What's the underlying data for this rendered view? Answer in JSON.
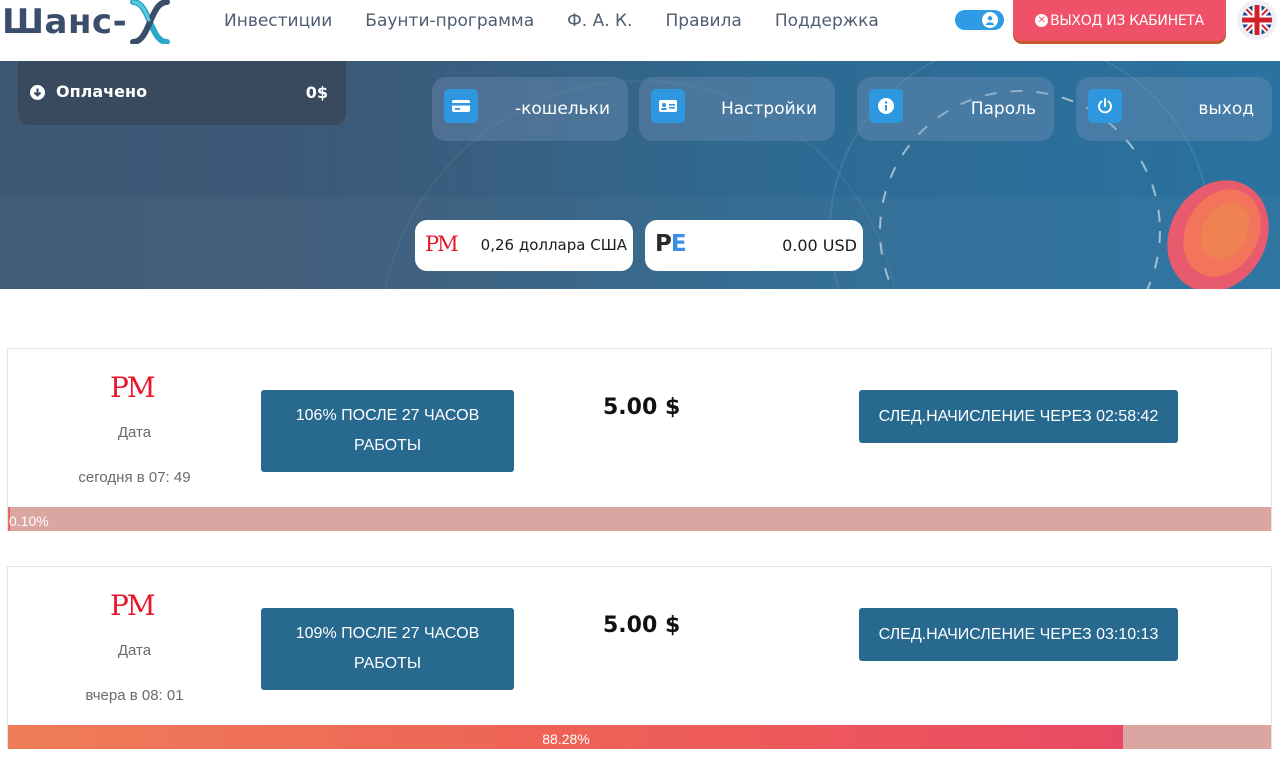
{
  "brand": {
    "name": "Шанс-"
  },
  "nav": {
    "items": [
      {
        "label": "Инвестиции"
      },
      {
        "label": "Баунти-программа"
      },
      {
        "label": "Ф. А. К."
      },
      {
        "label": "Правила"
      },
      {
        "label": "Поддержка"
      }
    ]
  },
  "header": {
    "exit_label": "ВЫХОД ИЗ КАБИНЕТА",
    "language_icon": "uk-flag-icon"
  },
  "banner": {
    "paid_label": "Оплачено",
    "paid_value": "0$",
    "menu": [
      {
        "label": "-кошельки",
        "icon": "card-icon"
      },
      {
        "label": "Настройки",
        "icon": "id-card-icon"
      },
      {
        "label": "Пароль",
        "icon": "info-icon"
      },
      {
        "label": "выход",
        "icon": "power-icon"
      }
    ],
    "balances": [
      {
        "system": "PM",
        "value": "0,26 доллара США"
      },
      {
        "system": "PE",
        "value": "0.00 USD"
      }
    ]
  },
  "deposits": [
    {
      "system": "PM",
      "date_label": "Дата",
      "date": "сегодня в 07: 49",
      "plan_line1": "106% ПОСЛЕ 27 ЧАСОВ",
      "plan_line2": "РАБОТЫ",
      "amount": "5.00 $",
      "next_label": "СЛЕД.НАЧИСЛЕНИЕ ЧЕРЕЗ 02:58:42",
      "progress_text": "0.10%",
      "progress": 0.001
    },
    {
      "system": "PM",
      "date_label": "Дата",
      "date": "вчера в 08: 01",
      "plan_line1": "109% ПОСЛЕ 27 ЧАСОВ",
      "plan_line2": "РАБОТЫ",
      "amount": "5.00 $",
      "next_label": "СЛЕД.НАЧИСЛЕНИЕ ЧЕРЕЗ 03:10:13",
      "progress_text": "88.28%",
      "progress": 0.8828
    }
  ],
  "colors": {
    "accent_blue": "#286990",
    "exit_red": "#ef5168",
    "pm_red": "#e8162b",
    "progress_bg": "#dba5a1"
  }
}
